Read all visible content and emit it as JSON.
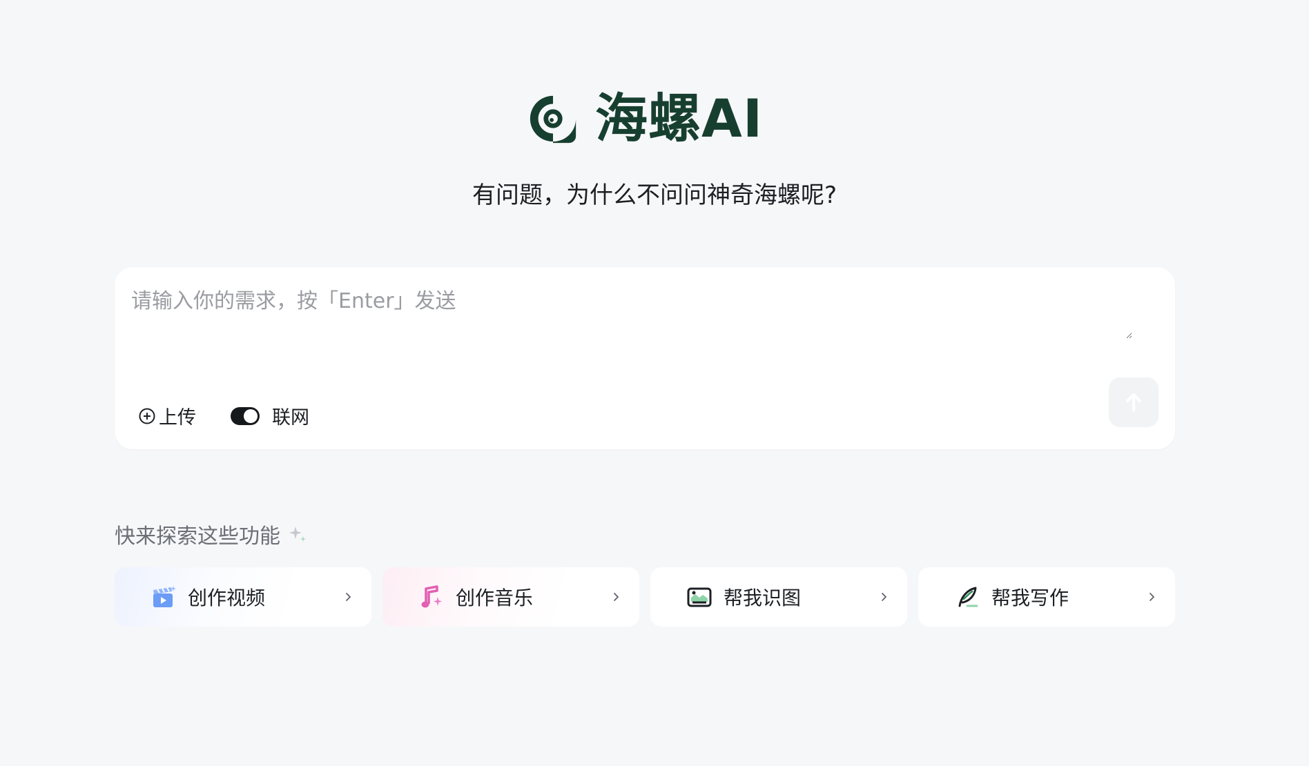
{
  "brand": {
    "name": "海螺AI",
    "logo_icon": "snail-shell-icon",
    "color": "#173f30"
  },
  "tagline": "有问题，为什么不问问神奇海螺呢?",
  "composer": {
    "placeholder": "请输入你的需求，按「Enter」发送",
    "value": "",
    "upload_label": "上传",
    "upload_icon": "plus-circle-icon",
    "web_search_label": "联网",
    "web_search_enabled": true,
    "send_icon": "arrow-up-icon"
  },
  "explore": {
    "heading": "快来探索这些功能",
    "heading_icon": "sparkle-icon",
    "cards": [
      {
        "label": "创作视频",
        "icon": "video-clapper-icon",
        "accent": "#5b8ff9"
      },
      {
        "label": "创作音乐",
        "icon": "music-note-icon",
        "accent": "#e35fb3"
      },
      {
        "label": "帮我识图",
        "icon": "image-recognition-icon",
        "accent": "#1c1f23"
      },
      {
        "label": "帮我写作",
        "icon": "quill-pen-icon",
        "accent": "#1e5c3a"
      }
    ]
  }
}
